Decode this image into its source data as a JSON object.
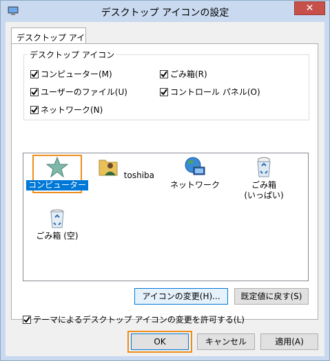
{
  "window": {
    "title": "デスクトップ アイコンの設定",
    "close_label": "✕"
  },
  "tab": {
    "label": "デスクトップ アイコン"
  },
  "group": {
    "legend": "デスクトップ アイコン",
    "checkboxes": [
      {
        "label": "コンピューター(M)",
        "checked": true
      },
      {
        "label": "ごみ箱(R)",
        "checked": true
      },
      {
        "label": "ユーザーのファイル(U)",
        "checked": true
      },
      {
        "label": "コントロール パネル(O)",
        "checked": true
      },
      {
        "label": "ネットワーク(N)",
        "checked": true
      }
    ]
  },
  "icons": [
    {
      "label": "コンピューター",
      "icon": "star-icon",
      "selected": true
    },
    {
      "label": "toshiba",
      "icon": "user-folder-icon"
    },
    {
      "label": "ネットワーク",
      "icon": "network-globe-icon"
    },
    {
      "label": "ごみ箱\n(いっぱい)",
      "icon": "recycle-bin-full-icon"
    },
    {
      "label": "ごみ箱 (空)",
      "icon": "recycle-bin-empty-icon"
    }
  ],
  "buttons": {
    "change_icon": "アイコンの変更(H)...",
    "restore_default": "既定値に戻す(S)",
    "ok": "OK",
    "cancel": "キャンセル",
    "apply": "適用(A)"
  },
  "theme_checkbox": {
    "label": "テーマによるデスクトップ アイコンの変更を許可する(L)",
    "checked": true
  },
  "colors": {
    "selection": "#0078d7",
    "highlight": "#ef8d1a",
    "close": "#c7504a"
  }
}
